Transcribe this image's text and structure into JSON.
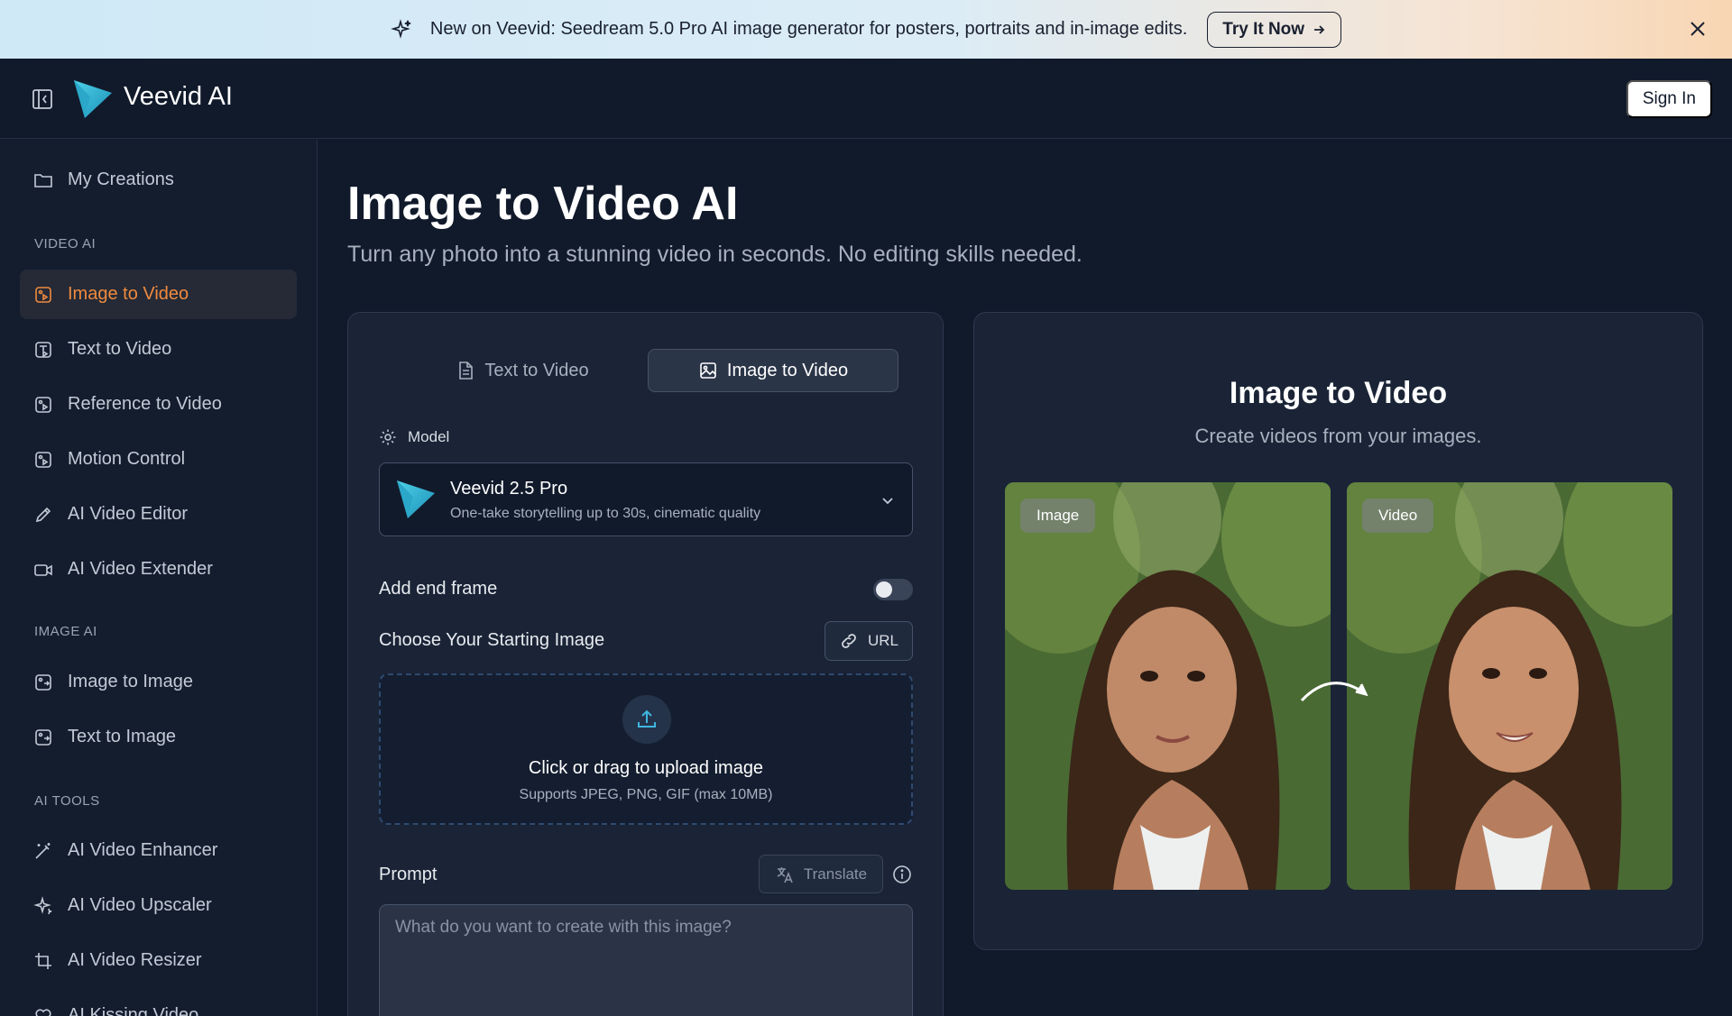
{
  "banner": {
    "text": "New on Veevid: Seedream 5.0 Pro AI image generator for posters, portraits and in-image edits.",
    "cta": "Try It Now"
  },
  "header": {
    "brand": "Veevid AI",
    "sign_in": "Sign In"
  },
  "sidebar": {
    "my_creations": "My Creations",
    "sections": {
      "video_ai": "VIDEO AI",
      "image_ai": "IMAGE AI",
      "ai_tools": "AI TOOLS"
    },
    "video_items": [
      {
        "label": "Image to Video",
        "active": true
      },
      {
        "label": "Text to Video"
      },
      {
        "label": "Reference to Video"
      },
      {
        "label": "Motion Control"
      },
      {
        "label": "AI Video Editor"
      },
      {
        "label": "AI Video Extender"
      }
    ],
    "image_items": [
      {
        "label": "Image to Image"
      },
      {
        "label": "Text to Image"
      }
    ],
    "tool_items": [
      {
        "label": "AI Video Enhancer"
      },
      {
        "label": "AI Video Upscaler"
      },
      {
        "label": "AI Video Resizer"
      },
      {
        "label": "AI Kissing Video"
      }
    ]
  },
  "main": {
    "title": "Image to Video AI",
    "subtitle": "Turn any photo into a stunning video in seconds. No editing skills needed."
  },
  "form": {
    "tabs": [
      {
        "label": "Text to Video",
        "active": false
      },
      {
        "label": "Image to Video",
        "active": true
      }
    ],
    "model_label": "Model",
    "model_name": "Veevid 2.5 Pro",
    "model_desc": "One-take storytelling up to 30s, cinematic quality",
    "end_frame_label": "Add end frame",
    "end_frame_enabled": false,
    "starting_image_label": "Choose Your Starting Image",
    "url_button": "URL",
    "upload_title": "Click or drag to upload image",
    "upload_sub": "Supports JPEG, PNG, GIF (max 10MB)",
    "prompt_label": "Prompt",
    "translate_button": "Translate",
    "prompt_placeholder": "What do you want to create with this image?"
  },
  "preview": {
    "title": "Image to Video",
    "subtitle": "Create videos from your images.",
    "image_badge": "Image",
    "video_badge": "Video"
  },
  "colors": {
    "background": "#111a2b",
    "accent": "#f08a3e",
    "panel": "#1a2436"
  }
}
